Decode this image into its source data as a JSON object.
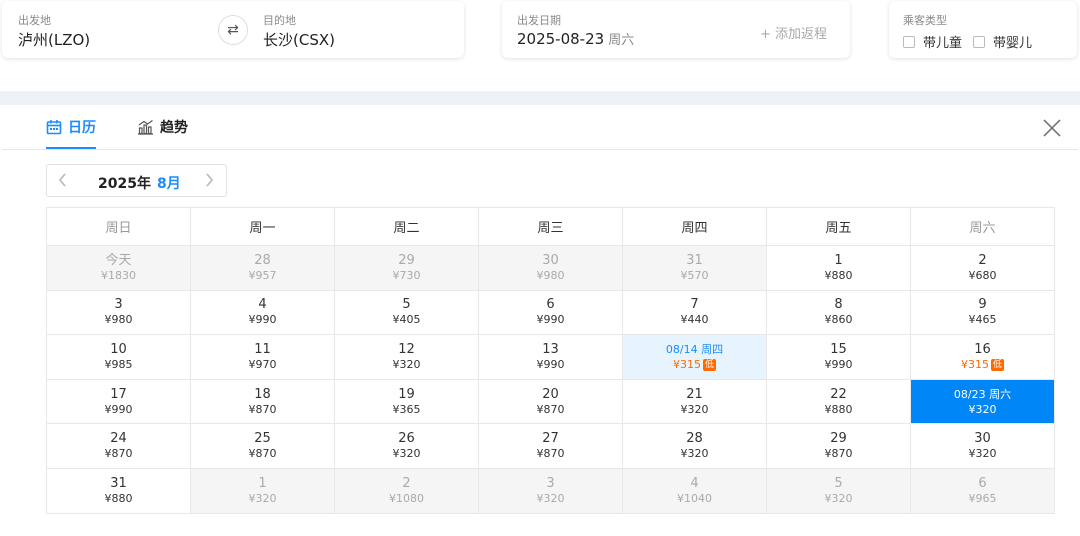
{
  "search": {
    "from_label": "出发地",
    "from_value": "泸州(LZO)",
    "to_label": "目的地",
    "to_value": "长沙(CSX)",
    "date_label": "出发日期",
    "date_value": "2025-08-23",
    "date_weekday": "周六",
    "return_label": "+ 添加返程",
    "pax_label": "乘客类型",
    "pax_child": "带儿童",
    "pax_infant": "带婴儿"
  },
  "tabs": {
    "calendar": "日历",
    "trend": "趋势"
  },
  "month_nav": {
    "year": "2025年",
    "month": "8月"
  },
  "calendar": {
    "headers": [
      "周日",
      "周一",
      "周二",
      "周三",
      "周四",
      "周五",
      "周六"
    ],
    "rows": [
      [
        {
          "day": "今天",
          "price": "¥1830",
          "state": "muted"
        },
        {
          "day": "28",
          "price": "¥957",
          "state": "muted"
        },
        {
          "day": "29",
          "price": "¥730",
          "state": "muted"
        },
        {
          "day": "30",
          "price": "¥980",
          "state": "muted"
        },
        {
          "day": "31",
          "price": "¥570",
          "state": "muted"
        },
        {
          "day": "1",
          "price": "¥880",
          "state": ""
        },
        {
          "day": "2",
          "price": "¥680",
          "state": ""
        }
      ],
      [
        {
          "day": "3",
          "price": "¥980",
          "state": ""
        },
        {
          "day": "4",
          "price": "¥990",
          "state": ""
        },
        {
          "day": "5",
          "price": "¥405",
          "state": ""
        },
        {
          "day": "6",
          "price": "¥990",
          "state": ""
        },
        {
          "day": "7",
          "price": "¥440",
          "state": ""
        },
        {
          "day": "8",
          "price": "¥860",
          "state": ""
        },
        {
          "day": "9",
          "price": "¥465",
          "state": ""
        }
      ],
      [
        {
          "day": "10",
          "price": "¥985",
          "state": ""
        },
        {
          "day": "11",
          "price": "¥970",
          "state": ""
        },
        {
          "day": "12",
          "price": "¥320",
          "state": ""
        },
        {
          "day": "13",
          "price": "¥990",
          "state": ""
        },
        {
          "day": "08/14 周四",
          "price": "¥315",
          "state": "lowest-sel",
          "badge": "低"
        },
        {
          "day": "15",
          "price": "¥990",
          "state": ""
        },
        {
          "day": "16",
          "price": "¥315",
          "state": "lowest",
          "badge": "低"
        }
      ],
      [
        {
          "day": "17",
          "price": "¥990",
          "state": ""
        },
        {
          "day": "18",
          "price": "¥870",
          "state": ""
        },
        {
          "day": "19",
          "price": "¥365",
          "state": ""
        },
        {
          "day": "20",
          "price": "¥870",
          "state": ""
        },
        {
          "day": "21",
          "price": "¥320",
          "state": ""
        },
        {
          "day": "22",
          "price": "¥880",
          "state": ""
        },
        {
          "day": "08/23 周六",
          "price": "¥320",
          "state": "selected"
        }
      ],
      [
        {
          "day": "24",
          "price": "¥870",
          "state": ""
        },
        {
          "day": "25",
          "price": "¥870",
          "state": ""
        },
        {
          "day": "26",
          "price": "¥320",
          "state": ""
        },
        {
          "day": "27",
          "price": "¥870",
          "state": ""
        },
        {
          "day": "28",
          "price": "¥320",
          "state": ""
        },
        {
          "day": "29",
          "price": "¥870",
          "state": ""
        },
        {
          "day": "30",
          "price": "¥320",
          "state": ""
        }
      ],
      [
        {
          "day": "31",
          "price": "¥880",
          "state": ""
        },
        {
          "day": "1",
          "price": "¥320",
          "state": "muted"
        },
        {
          "day": "2",
          "price": "¥1080",
          "state": "muted"
        },
        {
          "day": "3",
          "price": "¥320",
          "state": "muted"
        },
        {
          "day": "4",
          "price": "¥1040",
          "state": "muted"
        },
        {
          "day": "5",
          "price": "¥320",
          "state": "muted"
        },
        {
          "day": "6",
          "price": "¥965",
          "state": "muted"
        }
      ]
    ]
  },
  "colors": {
    "accent": "#1a8cff",
    "selected_bg": "#0086f6",
    "lowest_price": "#ff6a00"
  },
  "icons": {
    "calendar_tab": "calendar-icon",
    "trend_tab": "bar-chart-icon",
    "swap": "swap-icon",
    "close": "close-icon",
    "prev": "chevron-left-icon",
    "next": "chevron-right-icon"
  }
}
